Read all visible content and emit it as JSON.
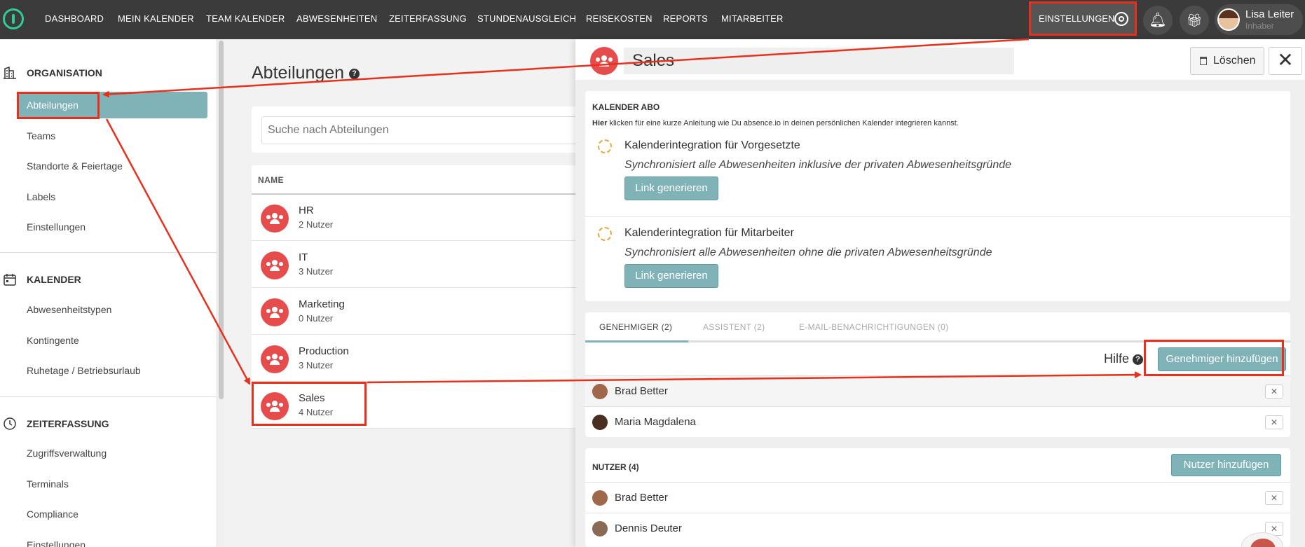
{
  "topnav": {
    "items": [
      "DASHBOARD",
      "MEIN KALENDER",
      "TEAM KALENDER",
      "ABWESENHEITEN",
      "ZEITERFASSUNG",
      "STUNDENAUSGLEICH",
      "REISEKOSTEN",
      "REPORTS",
      "MITARBEITER"
    ],
    "settings_label": "EINSTELLUNGEN",
    "user_name": "Lisa Leiter",
    "user_role": "Inhaber"
  },
  "sidebar": {
    "sections": [
      {
        "title": "ORGANISATION",
        "icon": "building-icon",
        "items": [
          "Abteilungen",
          "Teams",
          "Standorte & Feiertage",
          "Labels",
          "Einstellungen"
        ]
      },
      {
        "title": "KALENDER",
        "icon": "calendar-icon",
        "items": [
          "Abwesenheitstypen",
          "Kontingente",
          "Ruhetage / Betriebsurlaub"
        ]
      },
      {
        "title": "ZEITERFASSUNG",
        "icon": "clock-icon",
        "items": [
          "Zugriffsverwaltung",
          "Terminals",
          "Compliance",
          "Einstellungen"
        ]
      }
    ],
    "active_item": "Abteilungen"
  },
  "main": {
    "title": "Abteilungen",
    "search_placeholder": "Suche nach Abteilungen",
    "column_name": "NAME",
    "departments": [
      {
        "name": "HR",
        "users": "2 Nutzer"
      },
      {
        "name": "IT",
        "users": "3 Nutzer"
      },
      {
        "name": "Marketing",
        "users": "0 Nutzer"
      },
      {
        "name": "Production",
        "users": "3 Nutzer"
      },
      {
        "name": "Sales",
        "users": "4 Nutzer"
      }
    ]
  },
  "panel": {
    "title": "Sales",
    "delete_label": "Löschen",
    "close_label": "✕",
    "calendar": {
      "title": "KALENDER ABO",
      "hint_bold": "Hier",
      "hint_rest": " klicken für eine kurze Anleitung wie Du absence.io in deinen persönlichen Kalender integrieren kannst.",
      "rows": [
        {
          "title": "Kalenderintegration für Vorgesetzte",
          "desc": "Synchronisiert alle Abwesenheiten inklusive der privaten Abwesenheitsgründe",
          "button": "Link generieren"
        },
        {
          "title": "Kalenderintegration für Mitarbeiter",
          "desc": "Synchronisiert alle Abwesenheiten ohne die privaten Abwesenheitsgründe",
          "button": "Link generieren"
        }
      ]
    },
    "tabs": [
      "GENEHMIGER  (2)",
      "ASSISTENT  (2)",
      "E-MAIL-BENACHRICHTIGUNGEN  (0)"
    ],
    "help_label": "Hilfe",
    "add_approver_label": "Genehmiger hinzufügen",
    "approvers": [
      "Brad Better",
      "Maria Magdalena"
    ],
    "users_title": "NUTZER (4)",
    "add_user_label": "Nutzer hinzufügen",
    "users": [
      "Brad Better",
      "Dennis Deuter"
    ],
    "remove_label": "✕"
  },
  "colors": {
    "accent": "#80b3b8",
    "brand_green": "#2ecc9a",
    "department_icon": "#e74c4c",
    "annotation": "#e8301c"
  }
}
